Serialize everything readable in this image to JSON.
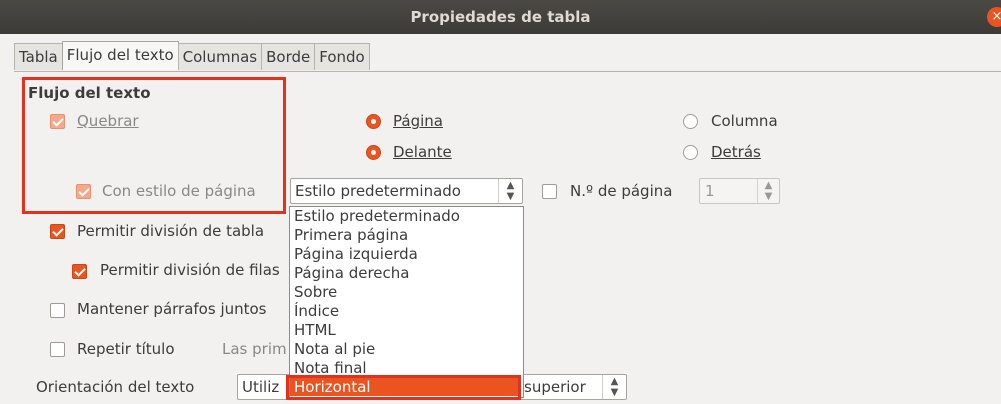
{
  "window": {
    "title": "Propiedades de tabla",
    "close_glyph": "×"
  },
  "tabs": [
    "Tabla",
    "Flujo del texto",
    "Columnas",
    "Borde",
    "Fondo"
  ],
  "section_heading": "Flujo del texto",
  "quebrar": {
    "label": "Quebrar",
    "checked": true,
    "enabled": false
  },
  "pagina_radio": {
    "label": "Página",
    "checked": true
  },
  "columna_radio": {
    "label": "Columna",
    "checked": false
  },
  "delante_radio": {
    "label": "Delante",
    "checked": true
  },
  "detras_radio": {
    "label": "Detrás",
    "checked": false
  },
  "con_estilo": {
    "label": "Con estilo de página",
    "checked": true,
    "enabled": false
  },
  "page_style_combo": {
    "value": "Estilo predeterminado"
  },
  "num_pagina": {
    "label": "N.º de página",
    "checked": false,
    "value": "1"
  },
  "permitir_tabla": {
    "label": "Permitir división de tabla",
    "checked": true
  },
  "permitir_filas": {
    "label": "Permitir división de filas",
    "checked": true
  },
  "mantener": {
    "label": "Mantener párrafos juntos",
    "checked": false
  },
  "repetir": {
    "label": "Repetir título",
    "checked": false,
    "secondary": "Las prim"
  },
  "orientacion": {
    "label": "Orientación del texto",
    "combo_left": "Utiliz",
    "combo_right": "superior"
  },
  "dropdown": {
    "items": [
      "Estilo predeterminado",
      "Primera página",
      "Página izquierda",
      "Página derecha",
      "Sobre",
      "Índice",
      "HTML",
      "Nota al pie",
      "Nota final",
      "Horizontal"
    ],
    "selected": "Horizontal"
  },
  "colors": {
    "accent": "#e95420",
    "highlight_box": "#e0321f",
    "titlebar": "#3c3b37"
  }
}
